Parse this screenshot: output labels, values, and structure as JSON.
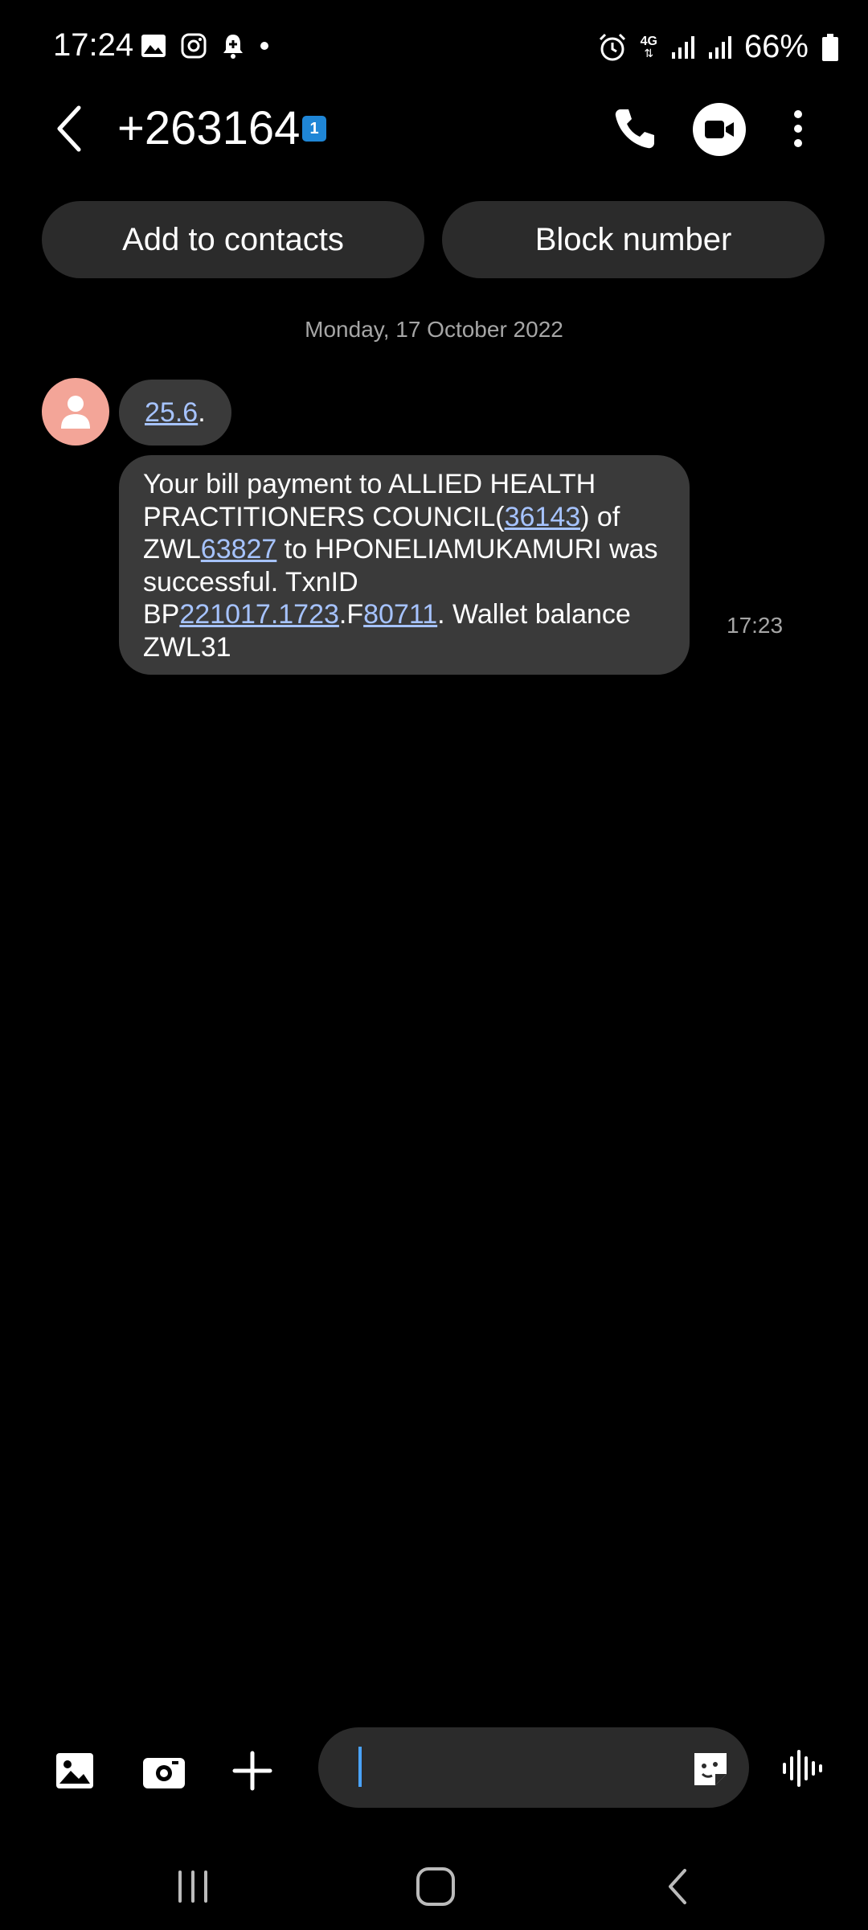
{
  "status_bar": {
    "time": "17:24",
    "network": "4G",
    "battery_percent": "66%"
  },
  "header": {
    "title": "+263164",
    "sim_badge": "1"
  },
  "actions": {
    "add_contact": "Add to contacts",
    "block_number": "Block number"
  },
  "conversation": {
    "date": "Monday, 17 October 2022",
    "first_message": {
      "link": "25.6",
      "suffix": "."
    },
    "message": {
      "segments": [
        {
          "t": "Your bill payment to ALLIED HEALTH PRACTITIONERS COUNCIL(",
          "link": false
        },
        {
          "t": "36143",
          "link": true
        },
        {
          "t": ") of ZWL",
          "link": false
        },
        {
          "t": "63827",
          "link": true
        },
        {
          "t": " to HPONELIAMUKAMURI was successful. TxnID BP",
          "link": false
        },
        {
          "t": "221017.1723",
          "link": true
        },
        {
          "t": ".F",
          "link": false
        },
        {
          "t": "80711",
          "link": true
        },
        {
          "t": ". Wallet balance ZWL31",
          "link": false
        }
      ],
      "time": "17:23"
    }
  },
  "colors": {
    "background": "#000000",
    "bubble": "#3a3a3a",
    "pill": "#2b2b2b",
    "link": "#a6c3ff",
    "avatar": "#f3a598",
    "sim_badge": "#1f86d6",
    "caret": "#4aa3ff"
  },
  "icons": {
    "status_left": [
      "gallery-icon",
      "instagram-icon",
      "notification-bell-icon",
      "dot-icon"
    ],
    "status_right": [
      "alarm-icon",
      "signal-icon",
      "signal-icon",
      "battery-icon"
    ],
    "composer": [
      "image-icon",
      "camera-icon",
      "plus-icon",
      "sticker-icon",
      "voice-icon"
    ],
    "nav": [
      "recents-icon",
      "home-icon",
      "back-icon"
    ]
  }
}
